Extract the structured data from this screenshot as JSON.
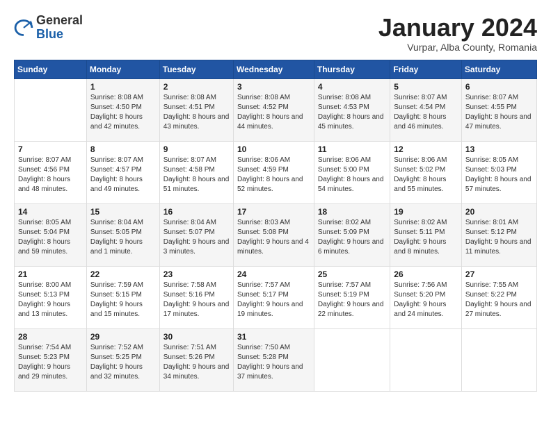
{
  "header": {
    "logo_general": "General",
    "logo_blue": "Blue",
    "month_title": "January 2024",
    "location": "Vurpar, Alba County, Romania"
  },
  "days_of_week": [
    "Sunday",
    "Monday",
    "Tuesday",
    "Wednesday",
    "Thursday",
    "Friday",
    "Saturday"
  ],
  "weeks": [
    [
      {
        "day": "",
        "sunrise": "",
        "sunset": "",
        "daylight": ""
      },
      {
        "day": "1",
        "sunrise": "Sunrise: 8:08 AM",
        "sunset": "Sunset: 4:50 PM",
        "daylight": "Daylight: 8 hours and 42 minutes."
      },
      {
        "day": "2",
        "sunrise": "Sunrise: 8:08 AM",
        "sunset": "Sunset: 4:51 PM",
        "daylight": "Daylight: 8 hours and 43 minutes."
      },
      {
        "day": "3",
        "sunrise": "Sunrise: 8:08 AM",
        "sunset": "Sunset: 4:52 PM",
        "daylight": "Daylight: 8 hours and 44 minutes."
      },
      {
        "day": "4",
        "sunrise": "Sunrise: 8:08 AM",
        "sunset": "Sunset: 4:53 PM",
        "daylight": "Daylight: 8 hours and 45 minutes."
      },
      {
        "day": "5",
        "sunrise": "Sunrise: 8:07 AM",
        "sunset": "Sunset: 4:54 PM",
        "daylight": "Daylight: 8 hours and 46 minutes."
      },
      {
        "day": "6",
        "sunrise": "Sunrise: 8:07 AM",
        "sunset": "Sunset: 4:55 PM",
        "daylight": "Daylight: 8 hours and 47 minutes."
      }
    ],
    [
      {
        "day": "7",
        "sunrise": "Sunrise: 8:07 AM",
        "sunset": "Sunset: 4:56 PM",
        "daylight": "Daylight: 8 hours and 48 minutes."
      },
      {
        "day": "8",
        "sunrise": "Sunrise: 8:07 AM",
        "sunset": "Sunset: 4:57 PM",
        "daylight": "Daylight: 8 hours and 49 minutes."
      },
      {
        "day": "9",
        "sunrise": "Sunrise: 8:07 AM",
        "sunset": "Sunset: 4:58 PM",
        "daylight": "Daylight: 8 hours and 51 minutes."
      },
      {
        "day": "10",
        "sunrise": "Sunrise: 8:06 AM",
        "sunset": "Sunset: 4:59 PM",
        "daylight": "Daylight: 8 hours and 52 minutes."
      },
      {
        "day": "11",
        "sunrise": "Sunrise: 8:06 AM",
        "sunset": "Sunset: 5:00 PM",
        "daylight": "Daylight: 8 hours and 54 minutes."
      },
      {
        "day": "12",
        "sunrise": "Sunrise: 8:06 AM",
        "sunset": "Sunset: 5:02 PM",
        "daylight": "Daylight: 8 hours and 55 minutes."
      },
      {
        "day": "13",
        "sunrise": "Sunrise: 8:05 AM",
        "sunset": "Sunset: 5:03 PM",
        "daylight": "Daylight: 8 hours and 57 minutes."
      }
    ],
    [
      {
        "day": "14",
        "sunrise": "Sunrise: 8:05 AM",
        "sunset": "Sunset: 5:04 PM",
        "daylight": "Daylight: 8 hours and 59 minutes."
      },
      {
        "day": "15",
        "sunrise": "Sunrise: 8:04 AM",
        "sunset": "Sunset: 5:05 PM",
        "daylight": "Daylight: 9 hours and 1 minute."
      },
      {
        "day": "16",
        "sunrise": "Sunrise: 8:04 AM",
        "sunset": "Sunset: 5:07 PM",
        "daylight": "Daylight: 9 hours and 3 minutes."
      },
      {
        "day": "17",
        "sunrise": "Sunrise: 8:03 AM",
        "sunset": "Sunset: 5:08 PM",
        "daylight": "Daylight: 9 hours and 4 minutes."
      },
      {
        "day": "18",
        "sunrise": "Sunrise: 8:02 AM",
        "sunset": "Sunset: 5:09 PM",
        "daylight": "Daylight: 9 hours and 6 minutes."
      },
      {
        "day": "19",
        "sunrise": "Sunrise: 8:02 AM",
        "sunset": "Sunset: 5:11 PM",
        "daylight": "Daylight: 9 hours and 8 minutes."
      },
      {
        "day": "20",
        "sunrise": "Sunrise: 8:01 AM",
        "sunset": "Sunset: 5:12 PM",
        "daylight": "Daylight: 9 hours and 11 minutes."
      }
    ],
    [
      {
        "day": "21",
        "sunrise": "Sunrise: 8:00 AM",
        "sunset": "Sunset: 5:13 PM",
        "daylight": "Daylight: 9 hours and 13 minutes."
      },
      {
        "day": "22",
        "sunrise": "Sunrise: 7:59 AM",
        "sunset": "Sunset: 5:15 PM",
        "daylight": "Daylight: 9 hours and 15 minutes."
      },
      {
        "day": "23",
        "sunrise": "Sunrise: 7:58 AM",
        "sunset": "Sunset: 5:16 PM",
        "daylight": "Daylight: 9 hours and 17 minutes."
      },
      {
        "day": "24",
        "sunrise": "Sunrise: 7:57 AM",
        "sunset": "Sunset: 5:17 PM",
        "daylight": "Daylight: 9 hours and 19 minutes."
      },
      {
        "day": "25",
        "sunrise": "Sunrise: 7:57 AM",
        "sunset": "Sunset: 5:19 PM",
        "daylight": "Daylight: 9 hours and 22 minutes."
      },
      {
        "day": "26",
        "sunrise": "Sunrise: 7:56 AM",
        "sunset": "Sunset: 5:20 PM",
        "daylight": "Daylight: 9 hours and 24 minutes."
      },
      {
        "day": "27",
        "sunrise": "Sunrise: 7:55 AM",
        "sunset": "Sunset: 5:22 PM",
        "daylight": "Daylight: 9 hours and 27 minutes."
      }
    ],
    [
      {
        "day": "28",
        "sunrise": "Sunrise: 7:54 AM",
        "sunset": "Sunset: 5:23 PM",
        "daylight": "Daylight: 9 hours and 29 minutes."
      },
      {
        "day": "29",
        "sunrise": "Sunrise: 7:52 AM",
        "sunset": "Sunset: 5:25 PM",
        "daylight": "Daylight: 9 hours and 32 minutes."
      },
      {
        "day": "30",
        "sunrise": "Sunrise: 7:51 AM",
        "sunset": "Sunset: 5:26 PM",
        "daylight": "Daylight: 9 hours and 34 minutes."
      },
      {
        "day": "31",
        "sunrise": "Sunrise: 7:50 AM",
        "sunset": "Sunset: 5:28 PM",
        "daylight": "Daylight: 9 hours and 37 minutes."
      },
      {
        "day": "",
        "sunrise": "",
        "sunset": "",
        "daylight": ""
      },
      {
        "day": "",
        "sunrise": "",
        "sunset": "",
        "daylight": ""
      },
      {
        "day": "",
        "sunrise": "",
        "sunset": "",
        "daylight": ""
      }
    ]
  ]
}
